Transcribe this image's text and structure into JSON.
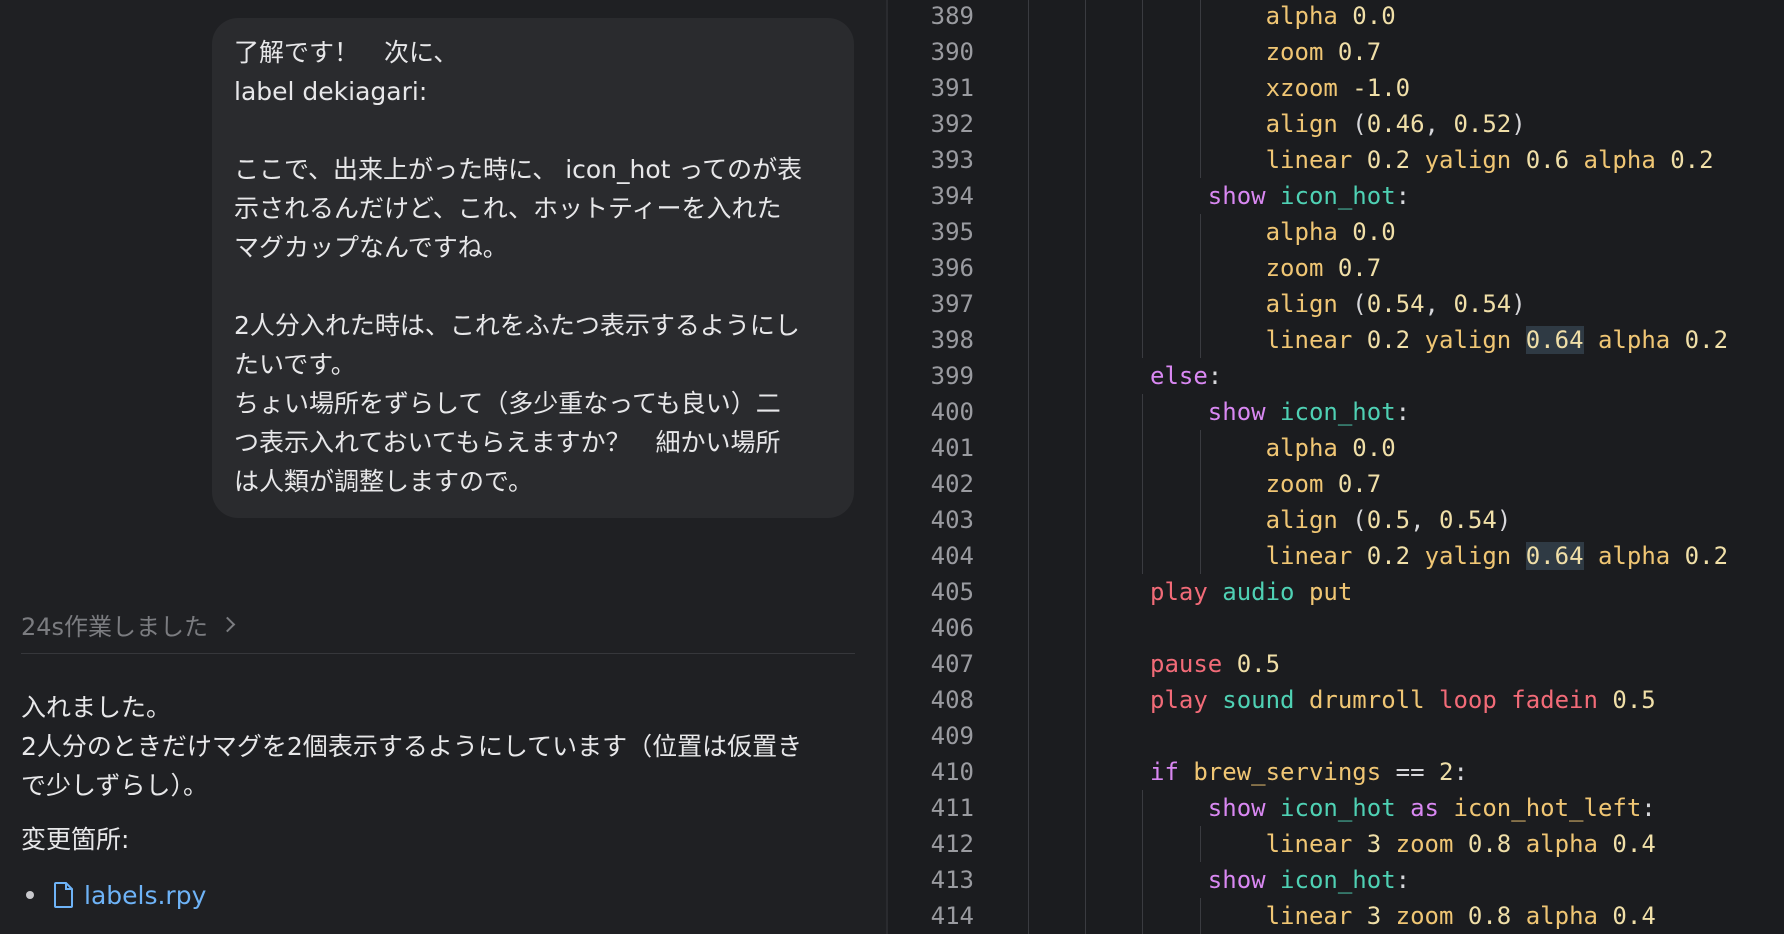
{
  "chat": {
    "user_message": "了解です！　次に、\nlabel dekiagari:\n\nここで、出来上がった時に、 icon_hot ってのが表\n示されるんだけど、これ、ホットティーを入れた\nマグカップなんですね。\n\n2人分入れた時は、これをふたつ表示するようにし\nたいです。\nちょい場所をずらして（多少重なっても良い）二\nつ表示入れておいてもらえますか？　細かい場所\nは人類が調整しますので。",
    "work_status": "24s作業しました",
    "reply": "入れました。\n2人分のときだけマグを2個表示するようにしています（位置は仮置き\nで少しずらし）。",
    "changes_label": "変更箇所:",
    "changed_file": "labels.rpy"
  },
  "editor": {
    "lines": [
      {
        "n": "389",
        "indent": 4,
        "tokens": [
          [
            "prop",
            "alpha"
          ],
          [
            "p",
            " "
          ],
          [
            "num",
            "0.0"
          ]
        ]
      },
      {
        "n": "390",
        "indent": 4,
        "tokens": [
          [
            "prop",
            "zoom"
          ],
          [
            "p",
            " "
          ],
          [
            "num",
            "0.7"
          ]
        ]
      },
      {
        "n": "391",
        "indent": 4,
        "tokens": [
          [
            "prop",
            "xzoom"
          ],
          [
            "p",
            " "
          ],
          [
            "num",
            "-1.0"
          ]
        ]
      },
      {
        "n": "392",
        "indent": 4,
        "tokens": [
          [
            "prop",
            "align"
          ],
          [
            "p",
            " ("
          ],
          [
            "num",
            "0.46"
          ],
          [
            "p",
            ", "
          ],
          [
            "num",
            "0.52"
          ],
          [
            "p",
            ")"
          ]
        ]
      },
      {
        "n": "393",
        "indent": 4,
        "tokens": [
          [
            "prop",
            "linear"
          ],
          [
            "p",
            " "
          ],
          [
            "num",
            "0.2"
          ],
          [
            "p",
            " "
          ],
          [
            "prop",
            "yalign"
          ],
          [
            "p",
            " "
          ],
          [
            "num",
            "0.6"
          ],
          [
            "p",
            " "
          ],
          [
            "prop",
            "alpha"
          ],
          [
            "p",
            " "
          ],
          [
            "num",
            "0.2"
          ]
        ]
      },
      {
        "n": "394",
        "indent": 2,
        "tokens": [
          [
            "ctl",
            "show"
          ],
          [
            "p",
            " "
          ],
          [
            "name",
            "icon_hot"
          ],
          [
            "p",
            ":"
          ]
        ]
      },
      {
        "n": "395",
        "indent": 4,
        "tokens": [
          [
            "prop",
            "alpha"
          ],
          [
            "p",
            " "
          ],
          [
            "num",
            "0.0"
          ]
        ]
      },
      {
        "n": "396",
        "indent": 4,
        "tokens": [
          [
            "prop",
            "zoom"
          ],
          [
            "p",
            " "
          ],
          [
            "num",
            "0.7"
          ]
        ]
      },
      {
        "n": "397",
        "indent": 4,
        "tokens": [
          [
            "prop",
            "align"
          ],
          [
            "p",
            " ("
          ],
          [
            "num",
            "0.54"
          ],
          [
            "p",
            ", "
          ],
          [
            "num",
            "0.54"
          ],
          [
            "p",
            ")"
          ]
        ]
      },
      {
        "n": "398",
        "indent": 4,
        "tokens": [
          [
            "prop",
            "linear"
          ],
          [
            "p",
            " "
          ],
          [
            "num",
            "0.2"
          ],
          [
            "p",
            " "
          ],
          [
            "prop",
            "yalign"
          ],
          [
            "p",
            " "
          ],
          [
            "num hl",
            "0.64"
          ],
          [
            "p",
            " "
          ],
          [
            "prop",
            "alpha"
          ],
          [
            "p",
            " "
          ],
          [
            "num",
            "0.2"
          ]
        ]
      },
      {
        "n": "399",
        "indent": 0,
        "tokens": [
          [
            "ctl",
            "else"
          ],
          [
            "p",
            ":"
          ]
        ]
      },
      {
        "n": "400",
        "indent": 2,
        "tokens": [
          [
            "ctl",
            "show"
          ],
          [
            "p",
            " "
          ],
          [
            "name",
            "icon_hot"
          ],
          [
            "p",
            ":"
          ]
        ]
      },
      {
        "n": "401",
        "indent": 4,
        "tokens": [
          [
            "prop",
            "alpha"
          ],
          [
            "p",
            " "
          ],
          [
            "num",
            "0.0"
          ]
        ]
      },
      {
        "n": "402",
        "indent": 4,
        "tokens": [
          [
            "prop",
            "zoom"
          ],
          [
            "p",
            " "
          ],
          [
            "num",
            "0.7"
          ]
        ]
      },
      {
        "n": "403",
        "indent": 4,
        "tokens": [
          [
            "prop",
            "align"
          ],
          [
            "p",
            " ("
          ],
          [
            "num",
            "0.5"
          ],
          [
            "p",
            ", "
          ],
          [
            "num",
            "0.54"
          ],
          [
            "p",
            ")"
          ]
        ]
      },
      {
        "n": "404",
        "indent": 4,
        "tokens": [
          [
            "prop",
            "linear"
          ],
          [
            "p",
            " "
          ],
          [
            "num",
            "0.2"
          ],
          [
            "p",
            " "
          ],
          [
            "prop",
            "yalign"
          ],
          [
            "p",
            " "
          ],
          [
            "num hl",
            "0.64"
          ],
          [
            "p",
            " "
          ],
          [
            "prop",
            "alpha"
          ],
          [
            "p",
            " "
          ],
          [
            "num",
            "0.2"
          ]
        ]
      },
      {
        "n": "405",
        "indent": 0,
        "tokens": [
          [
            "kw",
            "play"
          ],
          [
            "p",
            " "
          ],
          [
            "name",
            "audio"
          ],
          [
            "p",
            " "
          ],
          [
            "prop",
            "put"
          ]
        ]
      },
      {
        "n": "406",
        "indent": 0,
        "tokens": []
      },
      {
        "n": "407",
        "indent": 0,
        "tokens": [
          [
            "kw",
            "pause"
          ],
          [
            "p",
            " "
          ],
          [
            "num",
            "0.5"
          ]
        ]
      },
      {
        "n": "408",
        "indent": 0,
        "tokens": [
          [
            "kw",
            "play"
          ],
          [
            "p",
            " "
          ],
          [
            "name",
            "sound"
          ],
          [
            "p",
            " "
          ],
          [
            "prop",
            "drumroll"
          ],
          [
            "p",
            " "
          ],
          [
            "kw",
            "loop"
          ],
          [
            "p",
            " "
          ],
          [
            "kw",
            "fadein"
          ],
          [
            "p",
            " "
          ],
          [
            "num",
            "0.5"
          ]
        ]
      },
      {
        "n": "409",
        "indent": 0,
        "tokens": []
      },
      {
        "n": "410",
        "indent": 0,
        "tokens": [
          [
            "ctl",
            "if"
          ],
          [
            "p",
            " "
          ],
          [
            "prop",
            "brew_servings"
          ],
          [
            "p",
            " == "
          ],
          [
            "num",
            "2"
          ],
          [
            "p",
            ":"
          ]
        ]
      },
      {
        "n": "411",
        "indent": 2,
        "tokens": [
          [
            "ctl",
            "show"
          ],
          [
            "p",
            " "
          ],
          [
            "name",
            "icon_hot"
          ],
          [
            "p",
            " "
          ],
          [
            "ctl",
            "as"
          ],
          [
            "p",
            " "
          ],
          [
            "prop",
            "icon_hot_left"
          ],
          [
            "p",
            ":"
          ]
        ]
      },
      {
        "n": "412",
        "indent": 4,
        "tokens": [
          [
            "prop",
            "linear"
          ],
          [
            "p",
            " "
          ],
          [
            "num",
            "3"
          ],
          [
            "p",
            " "
          ],
          [
            "prop",
            "zoom"
          ],
          [
            "p",
            " "
          ],
          [
            "num",
            "0.8"
          ],
          [
            "p",
            " "
          ],
          [
            "prop",
            "alpha"
          ],
          [
            "p",
            " "
          ],
          [
            "num",
            "0.4"
          ]
        ]
      },
      {
        "n": "413",
        "indent": 2,
        "tokens": [
          [
            "ctl",
            "show"
          ],
          [
            "p",
            " "
          ],
          [
            "name",
            "icon_hot"
          ],
          [
            "p",
            ":"
          ]
        ]
      },
      {
        "n": "414",
        "indent": 4,
        "tokens": [
          [
            "prop",
            "linear"
          ],
          [
            "p",
            " "
          ],
          [
            "num",
            "3"
          ],
          [
            "p",
            " "
          ],
          [
            "prop",
            "zoom"
          ],
          [
            "p",
            " "
          ],
          [
            "num",
            "0.8"
          ],
          [
            "p",
            " "
          ],
          [
            "prop",
            "alpha"
          ],
          [
            "p",
            " "
          ],
          [
            "num",
            "0.4"
          ]
        ]
      }
    ]
  }
}
